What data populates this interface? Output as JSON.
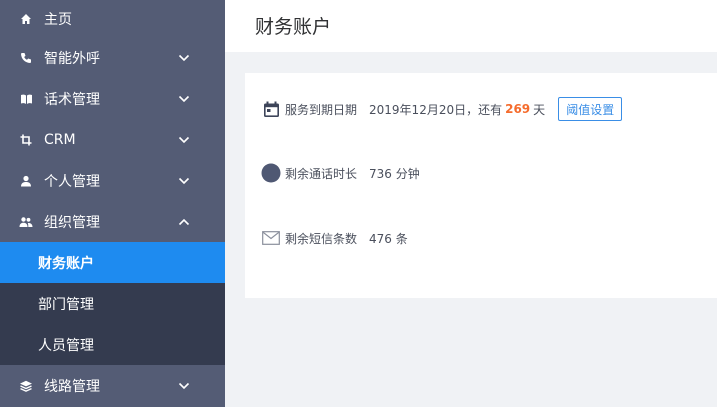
{
  "sidebar": {
    "items": [
      {
        "label": "主页",
        "icon": "home-icon"
      },
      {
        "label": "智能外呼",
        "icon": "phone-icon"
      },
      {
        "label": "话术管理",
        "icon": "book-icon"
      },
      {
        "label": "CRM",
        "icon": "crop-icon"
      },
      {
        "label": "个人管理",
        "icon": "user-icon"
      },
      {
        "label": "组织管理",
        "icon": "group-icon",
        "expanded": true
      }
    ],
    "sub_items": [
      {
        "label": "财务账户",
        "active": true
      },
      {
        "label": "部门管理"
      },
      {
        "label": "人员管理"
      }
    ],
    "last_item": {
      "label": "线路管理",
      "icon": "layers-icon"
    }
  },
  "page": {
    "title": "财务账户"
  },
  "account": {
    "service": {
      "label": "服务到期日期",
      "date_text": "2019年12月20日，还有",
      "days": "269",
      "unit": "天",
      "button": "阈值设置"
    },
    "call_time": {
      "label": "剩余通话时长",
      "value": "736 分钟"
    },
    "sms": {
      "label": "剩余短信条数",
      "value": "476 条"
    }
  },
  "colors": {
    "sidebar_bg": "#545c75",
    "submenu_bg": "#343b4f",
    "active_bg": "#1e8bf0",
    "accent": "#f56c2d",
    "link": "#3a8ee6"
  }
}
